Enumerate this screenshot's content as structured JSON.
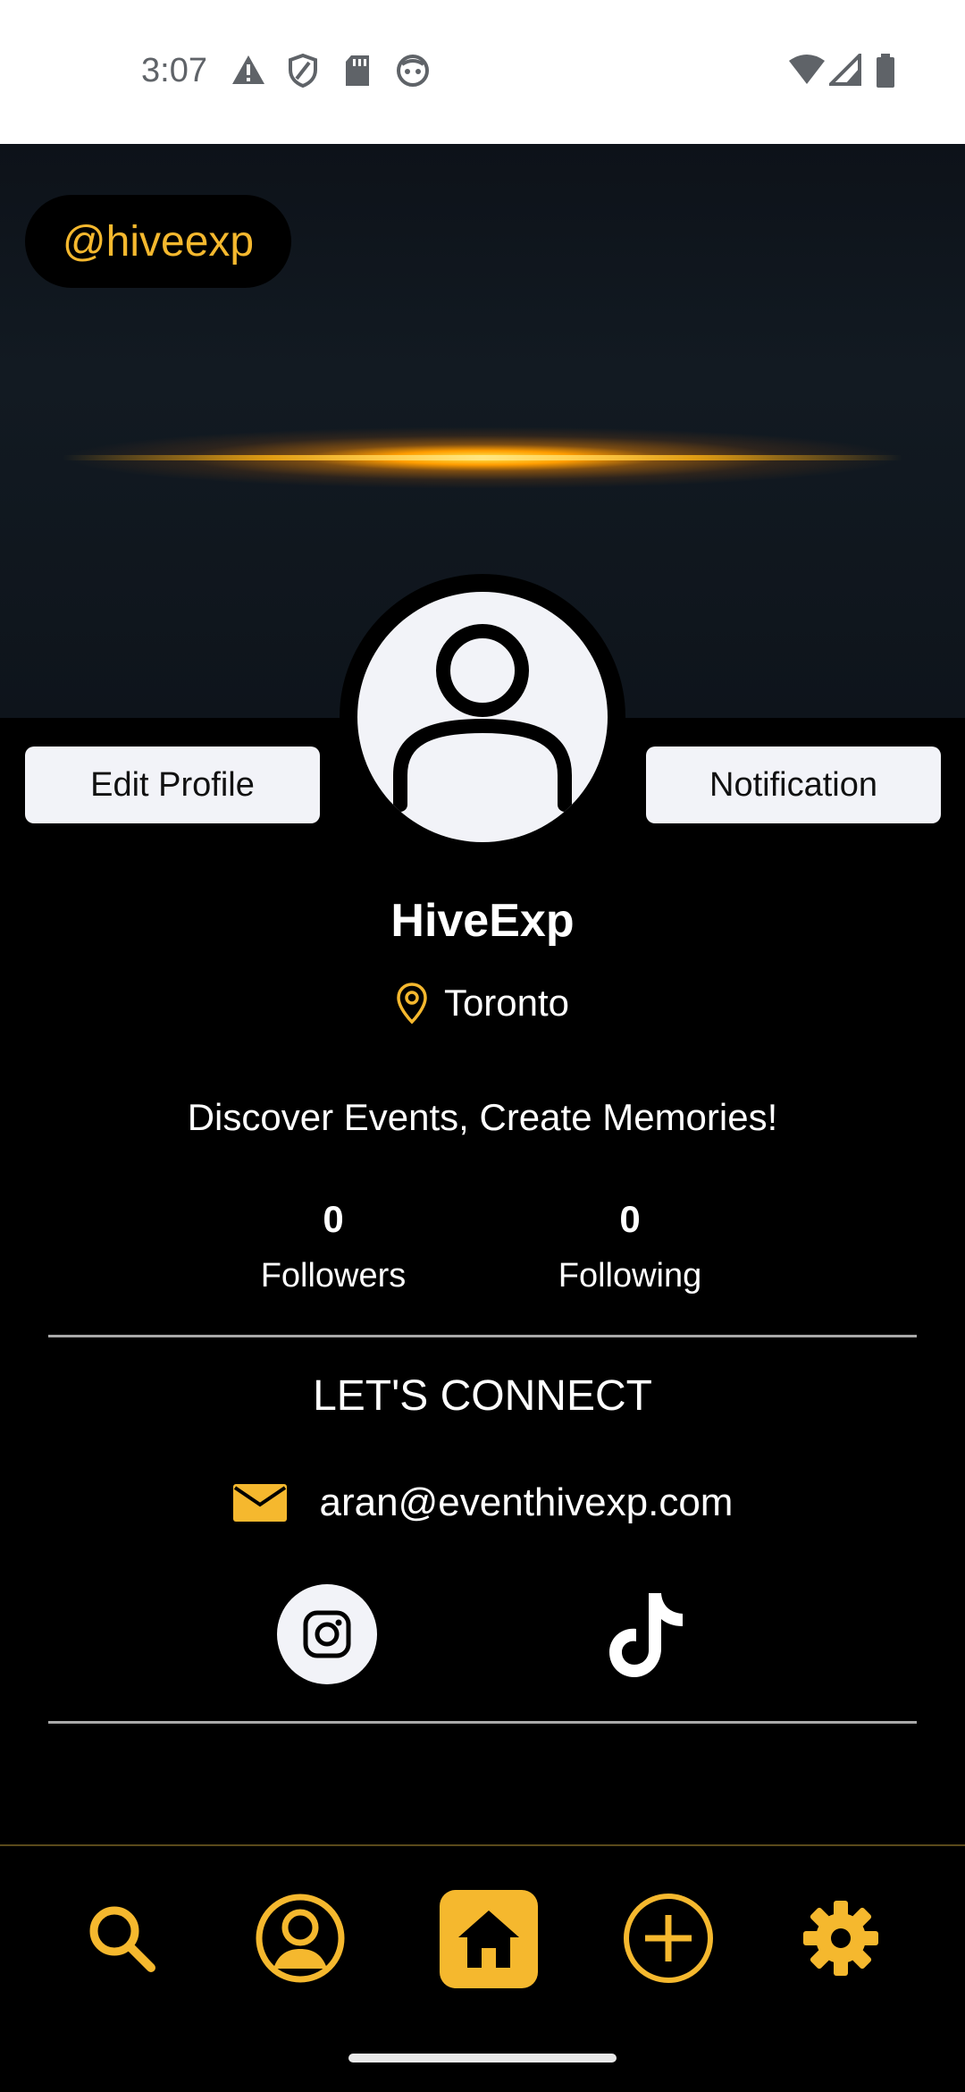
{
  "status_bar": {
    "time": "3:07",
    "left_icons": [
      "warning-icon",
      "shield-icon",
      "sd-card-icon",
      "face-icon"
    ],
    "right_icons": [
      "wifi-icon",
      "signal-icon",
      "battery-icon"
    ]
  },
  "banner": {
    "handle": "@hiveexp"
  },
  "profile": {
    "edit_label": "Edit Profile",
    "notification_label": "Notification",
    "name": "HiveExp",
    "location": "Toronto",
    "bio": "Discover Events, Create Memories!",
    "followers_count": "0",
    "followers_label": "Followers",
    "following_count": "0",
    "following_label": "Following"
  },
  "connect": {
    "title": "LET'S CONNECT",
    "email": "aran@eventhivexp.com",
    "socials": [
      "instagram-icon",
      "tiktok-icon"
    ]
  },
  "nav": {
    "items": [
      "search-icon",
      "profile-icon",
      "home-icon",
      "add-icon",
      "settings-icon"
    ],
    "active": "home-icon"
  },
  "colors": {
    "accent": "#f5b82e",
    "background": "#000000",
    "button_bg": "#f2f3f8"
  }
}
